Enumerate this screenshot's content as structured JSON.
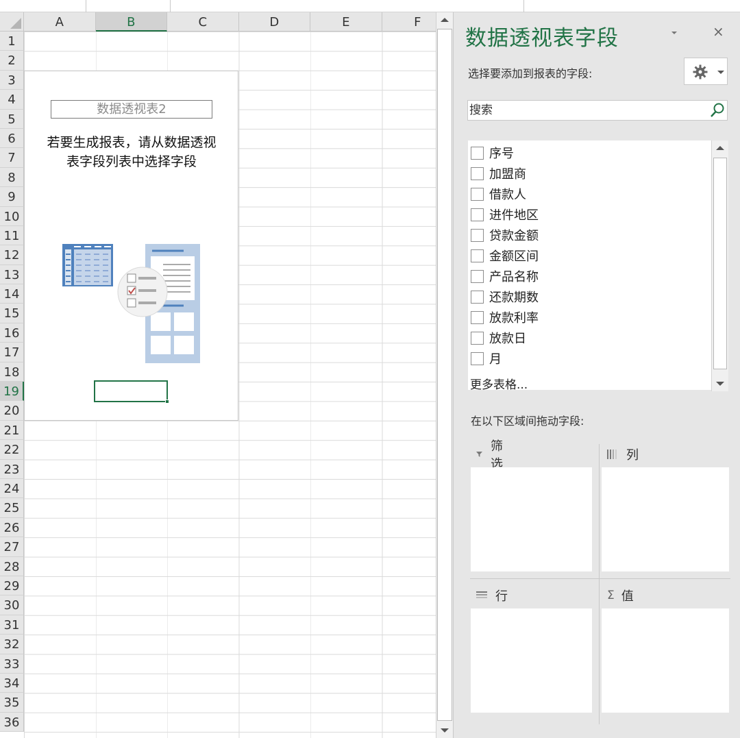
{
  "sheet": {
    "columns": [
      "A",
      "B",
      "C",
      "D",
      "E",
      "F"
    ],
    "selected_column": "B",
    "rows": [
      "1",
      "2",
      "3",
      "4",
      "5",
      "6",
      "7",
      "8",
      "9",
      "10",
      "11",
      "12",
      "13",
      "14",
      "15",
      "16",
      "17",
      "18",
      "19",
      "20",
      "21",
      "22",
      "23",
      "24",
      "25",
      "26",
      "27",
      "28",
      "29",
      "30",
      "31",
      "32",
      "33",
      "34",
      "35",
      "36"
    ],
    "selected_row": "19",
    "pivot_table": {
      "name": "数据透视表2",
      "instruction_line1": "若要生成报表，请从数据透视",
      "instruction_line2": "表字段列表中选择字段"
    }
  },
  "pane": {
    "title": "数据透视表字段",
    "choose_label": "选择要添加到报表的字段:",
    "search_placeholder": "搜索",
    "fields": [
      {
        "label": "序号",
        "checked": false
      },
      {
        "label": "加盟商",
        "checked": false
      },
      {
        "label": "借款人",
        "checked": false
      },
      {
        "label": "进件地区",
        "checked": false
      },
      {
        "label": "贷款金额",
        "checked": false
      },
      {
        "label": "金额区间",
        "checked": false
      },
      {
        "label": "产品名称",
        "checked": false
      },
      {
        "label": "还款期数",
        "checked": false
      },
      {
        "label": "放款利率",
        "checked": false
      },
      {
        "label": "放款日",
        "checked": false
      },
      {
        "label": "月",
        "checked": false
      }
    ],
    "more_tables": "更多表格...",
    "drag_label": "在以下区域间拖动字段:",
    "areas": {
      "filters": "筛选",
      "columns": "列",
      "rows": "行",
      "values": "值"
    },
    "close_glyph": "×"
  },
  "colors": {
    "accent_green": "#217346",
    "pane_bg": "#e6e6e6",
    "header_bg": "#e6e6e6",
    "illustration_blue": "#4f81bd"
  }
}
